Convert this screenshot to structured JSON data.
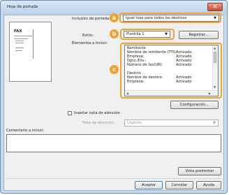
{
  "window": {
    "title": "Hoja de portada",
    "close_glyph": "✕"
  },
  "inclusion": {
    "label": "Inclusión de portada:",
    "value": "Igual hoja para todos los destinos"
  },
  "style": {
    "label": "Estilo:",
    "value": "Plantilla 1",
    "register_label": "Registrar..."
  },
  "elements": {
    "label": "Elementos a incluir:",
    "rows": [
      {
        "key": "Remitente",
        "value": ""
      },
      {
        "key": "Nombre de remitente (TTI):",
        "value": "Activado"
      },
      {
        "key": "Empresa:",
        "value": "Activado"
      },
      {
        "key": "Dpto./Div.:",
        "value": "Activado"
      },
      {
        "key": "Número de fax/URI:",
        "value": "Activado"
      },
      {
        "key": "",
        "value": ""
      },
      {
        "key": "Destino",
        "value": ""
      },
      {
        "key": "Nombre de destino:",
        "value": "Activado"
      },
      {
        "key": "Empresa:",
        "value": "Activado"
      }
    ]
  },
  "configuration_label": "Configuración...",
  "attention": {
    "checkbox_label": "Insertar nota de atención",
    "field_label": "Nota de atención:",
    "value": "Urgente"
  },
  "comment_label": "Comentario a incluir:",
  "preview_button": "Vista preliminar",
  "footer": {
    "ok": "Aceptar",
    "cancel": "Cancelar",
    "help": "Ayuda"
  },
  "callouts": {
    "a": "a",
    "b": "b",
    "c": "c"
  },
  "preview_page": {
    "fax_text": "FAX"
  },
  "colors": {
    "callout": "#f0a233",
    "window_frame": "#c9dbef",
    "dialog_bg": "#f0f0f0"
  }
}
